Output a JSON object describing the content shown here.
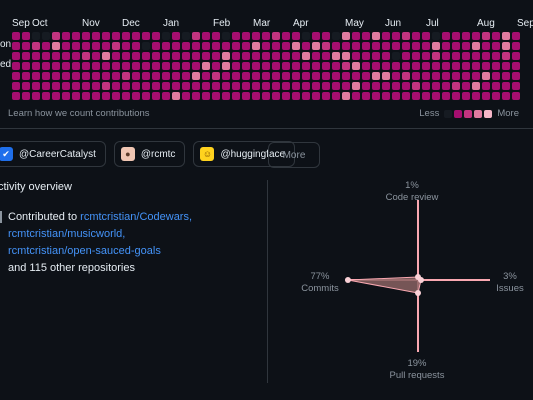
{
  "contribution_graph": {
    "months": [
      "Sep",
      "Oct",
      "Nov",
      "Dec",
      "Jan",
      "Feb",
      "Mar",
      "Apr",
      "May",
      "Jun",
      "Jul",
      "Aug",
      "Sep"
    ],
    "day_labels": [
      "on",
      "ed"
    ],
    "levels": [
      "1100211111111110102110111121101103113112110111121311",
      "1121311111211011111111113111313211111111113111311311",
      "1111111213111111111113111111131133111101112111111213",
      "1111111111111111111313111111111112311111111111111111",
      "1111111111121111113121111111111111113312111111131111",
      "1111111112111111111111111111111111311111211121311111",
      "1111111111111111311111111111111113111111111111111111"
    ],
    "level_colors": [
      "#161b22",
      "#a50e6f",
      "#c2347f",
      "#e07ba0",
      "#f7b7c8"
    ],
    "learn_link": "Learn how we count contributions",
    "legend_less": "Less",
    "legend_more": "More"
  },
  "organizations": [
    {
      "name": "@CareerCatalyst",
      "avatar": "✔",
      "avatar_bg": "#1f6feb",
      "avatar_fg": "#ffffff"
    },
    {
      "name": "@rcmtc",
      "avatar": "●",
      "avatar_bg": "#f0c6b3",
      "avatar_fg": "#5b3a29"
    },
    {
      "name": "@huggingface",
      "avatar": "☺",
      "avatar_bg": "#ffd21e",
      "avatar_fg": "#7a4a00"
    }
  ],
  "more_button": "More",
  "activity": {
    "title": "ctivity overview",
    "contributed_prefix": "Contributed to",
    "repos": [
      "rcmtcristian/Codewars,",
      "rcmtcristian/musicworld,",
      "rcmtcristian/open-sauced-goals"
    ],
    "others": "and 115 other repositories"
  },
  "radar": {
    "code_review": {
      "pct": "1%",
      "label": "Code review",
      "value": 1
    },
    "issues": {
      "pct": "3%",
      "label": "Issues",
      "value": 3
    },
    "pull_requests": {
      "pct": "19%",
      "label": "Pull requests",
      "value": 19
    },
    "commits": {
      "pct": "77%",
      "label": "Commits",
      "value": 77
    },
    "color": "#f9a8b1"
  }
}
